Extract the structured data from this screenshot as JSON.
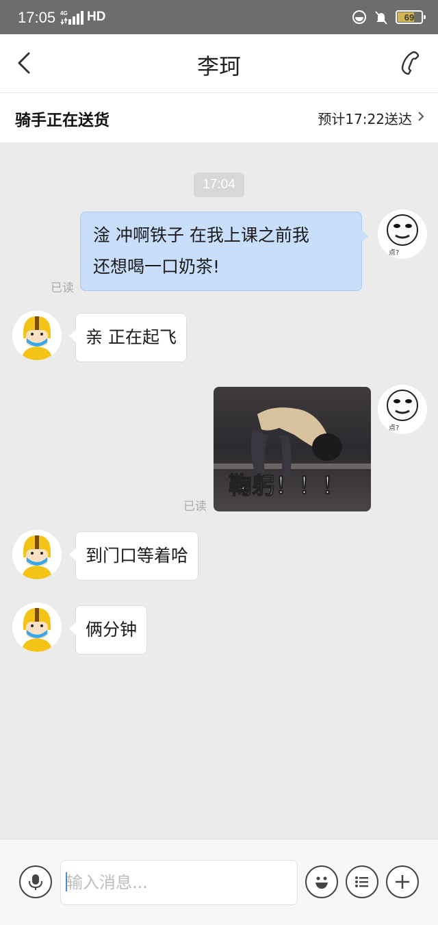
{
  "status_bar": {
    "time": "17:05",
    "network": "4G",
    "hd": "HD",
    "battery": "69"
  },
  "header": {
    "title": "李珂"
  },
  "delivery": {
    "status": "骑手正在送货",
    "eta": "预计17:22送达"
  },
  "chat": {
    "timestamp": "17:04",
    "messages": [
      {
        "side": "right",
        "type": "text",
        "lines": [
          "淦  冲啊铁子 在我上课之前我",
          "还想喝一口奶茶!"
        ],
        "read_label": "已读"
      },
      {
        "side": "left",
        "type": "text",
        "text": "亲  正在起飞"
      },
      {
        "side": "right",
        "type": "sticker",
        "caption": "鞠躬！！！",
        "read_label": "已读"
      },
      {
        "side": "left",
        "type": "text",
        "text": "到门口等着哈"
      },
      {
        "side": "left",
        "type": "text",
        "text": "俩分钟"
      }
    ],
    "my_avatar_caption": "点?"
  },
  "input_bar": {
    "placeholder": "输入消息..."
  },
  "icons": {
    "back": "chevron-left-icon",
    "call": "phone-icon",
    "eta": "chevron-right-icon",
    "voice": "microphone-icon",
    "emoji": "emoji-icon",
    "quick_reply": "list-icon",
    "more": "plus-icon"
  },
  "colors": {
    "my_bubble": "#c9defa",
    "other_bubble": "#ffffff",
    "chat_bg": "#ebebeb",
    "rider_helmet": "#f3c417"
  }
}
